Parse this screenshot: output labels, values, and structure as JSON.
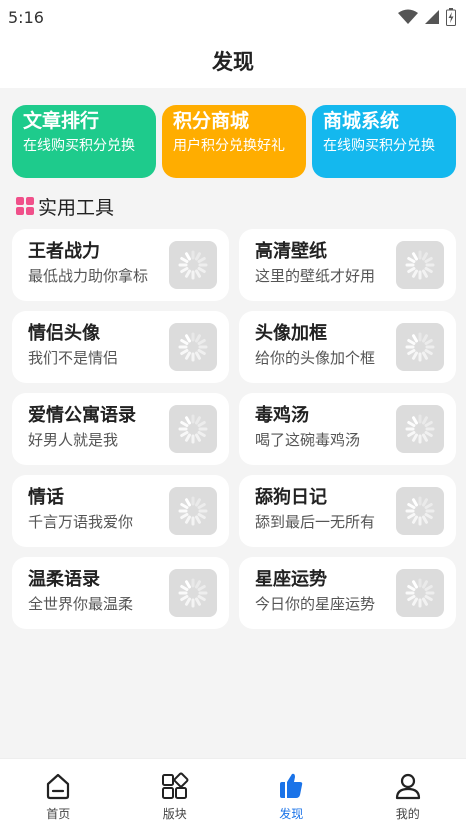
{
  "status_bar": {
    "time": "5:16"
  },
  "header": {
    "title": "发现"
  },
  "promo_cards": [
    {
      "title": "文章排行",
      "subtitle": "在线购买积分兑换",
      "color": "#1ecb8c"
    },
    {
      "title": "积分商城",
      "subtitle": "用户积分兑换好礼",
      "color": "#ffad00"
    },
    {
      "title": "商城系统",
      "subtitle": "在线购买积分兑换",
      "color": "#14b8ee"
    }
  ],
  "section": {
    "title": "实用工具",
    "icon": "grid-icon",
    "icon_color": "#f0508a"
  },
  "tools": [
    {
      "title": "王者战力",
      "desc": "最低战力助你拿标"
    },
    {
      "title": "高清壁纸",
      "desc": "这里的壁纸才好用"
    },
    {
      "title": "情侣头像",
      "desc": "我们不是情侣"
    },
    {
      "title": "头像加框",
      "desc": "给你的头像加个框"
    },
    {
      "title": "爱情公寓语录",
      "desc": "好男人就是我"
    },
    {
      "title": "毒鸡汤",
      "desc": "喝了这碗毒鸡汤"
    },
    {
      "title": "情话",
      "desc": "千言万语我爱你"
    },
    {
      "title": "舔狗日记",
      "desc": "舔到最后一无所有"
    },
    {
      "title": "温柔语录",
      "desc": "全世界你最温柔"
    },
    {
      "title": "星座运势",
      "desc": "今日你的星座运势"
    }
  ],
  "bottom_nav": [
    {
      "label": "首页",
      "icon": "home-icon",
      "active": false
    },
    {
      "label": "版块",
      "icon": "blocks-icon",
      "active": false
    },
    {
      "label": "发现",
      "icon": "discover-icon",
      "active": true
    },
    {
      "label": "我的",
      "icon": "user-icon",
      "active": false
    }
  ],
  "colors": {
    "accent": "#1a73e8",
    "background": "#f4f4f4"
  }
}
